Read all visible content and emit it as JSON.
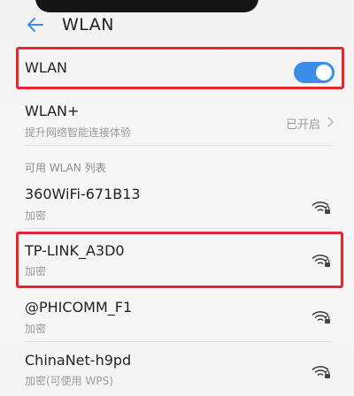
{
  "header": {
    "title": "WLAN"
  },
  "wlan_toggle": {
    "label": "WLAN",
    "enabled": true,
    "accent_color": "#3a8ee6"
  },
  "wlan_plus": {
    "title": "WLAN+",
    "subtitle": "提升网络智能连接体验",
    "status": "已开启"
  },
  "network_list": {
    "section_label": "可用 WLAN 列表",
    "networks": [
      {
        "ssid": "360WiFi-671B13",
        "security": "加密"
      },
      {
        "ssid": "TP-LINK_A3D0",
        "security": "加密"
      },
      {
        "ssid": "@PHICOMM_F1",
        "security": "加密"
      },
      {
        "ssid": "ChinaNet-h9pd",
        "security": "加密(可使用 WPS)"
      }
    ]
  },
  "annotations": {
    "highlight_color": "#e8262d"
  }
}
